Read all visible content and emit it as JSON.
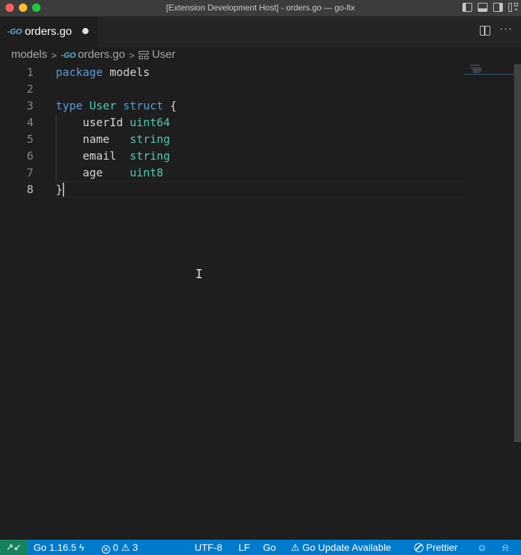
{
  "window": {
    "title": "[Extension Development Host] - orders.go — go-fix"
  },
  "tab": {
    "go_badge": "-GO",
    "filename": "orders.go"
  },
  "tab_actions": {
    "more": "···"
  },
  "breadcrumb": {
    "folder": "models",
    "file": "orders.go",
    "symbol": "User",
    "separator": ">"
  },
  "editor": {
    "line_numbers": [
      "1",
      "2",
      "3",
      "4",
      "5",
      "6",
      "7",
      "8"
    ],
    "lines": {
      "l1_kw": "package",
      "l1_rest": " models",
      "l3_kw1": "type",
      "l3_name": " User ",
      "l3_kw2": "struct",
      "l3_brace": " {",
      "l4_field": "    userId ",
      "l4_type": "uint64",
      "l5_field": "    name   ",
      "l5_type": "string",
      "l6_field": "    email  ",
      "l6_type": "string",
      "l7_field": "    age    ",
      "l7_type": "uint8",
      "l8": "}"
    },
    "active_line": "8"
  },
  "statusbar": {
    "remote_icon": "remote-icon",
    "go_version": "Go 1.16.5",
    "errors": "0",
    "warnings": "3",
    "encoding": "UTF-8",
    "eol": "LF",
    "language": "Go",
    "go_update": "Go Update Available",
    "prettier": "Prettier"
  },
  "colors": {
    "statusbar": "#007acc",
    "remote": "#16825d",
    "keyword": "#569cd6",
    "type": "#4ec9b0"
  }
}
